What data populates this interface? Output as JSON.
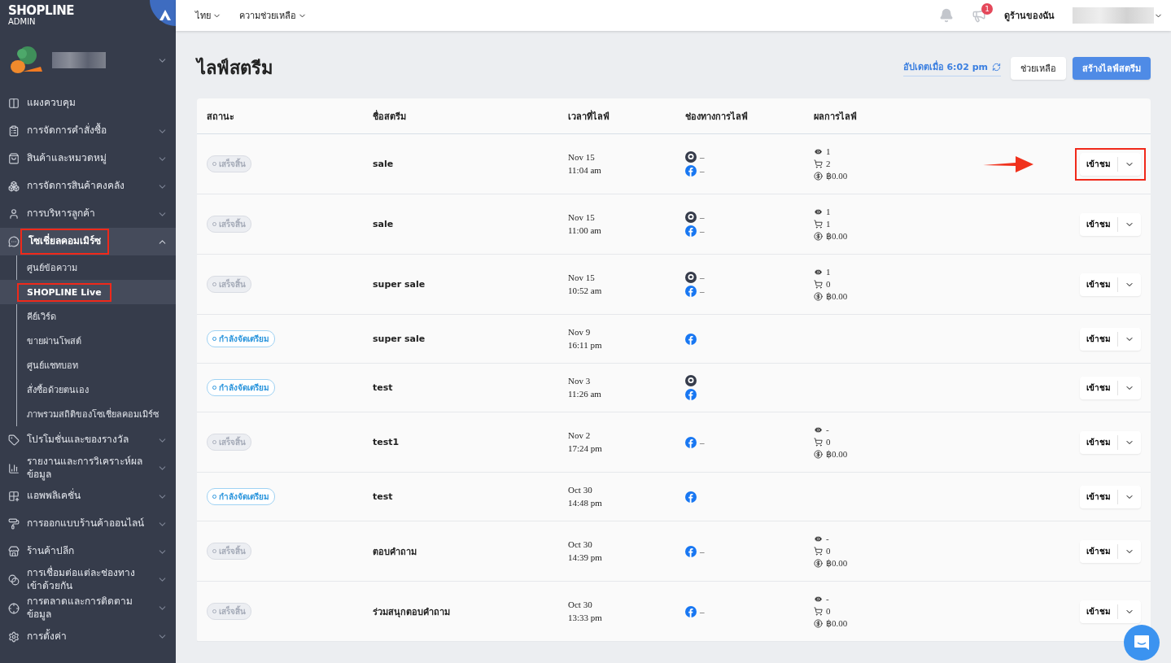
{
  "brand": {
    "name": "SHOPLINE",
    "sub": "ADMIN"
  },
  "sidebar": {
    "items": [
      {
        "label": "แผงควบคุม",
        "selected": false
      },
      {
        "label": "การจัดการคำสั่งซื้อ",
        "expanded": false,
        "selected": false
      },
      {
        "label": "สินค้าและหมวดหมู่",
        "expanded": false,
        "selected": false
      },
      {
        "label": "การจัดการสินค้าคงคลัง",
        "expanded": false,
        "selected": false
      },
      {
        "label": "การบริหารลูกค้า",
        "expanded": false,
        "selected": false
      },
      {
        "label": "โซเชี่ยลคอมเมิร์ซ",
        "expanded": true,
        "selected": true,
        "annotated": true,
        "children": [
          {
            "label": "ศูนย์ข้อความ",
            "selected": false
          },
          {
            "label": "SHOPLINE Live",
            "selected": true,
            "annotated": true
          },
          {
            "label": "คีย์เวิร์ด",
            "selected": false
          },
          {
            "label": "ขายผ่านโพสต์",
            "selected": false
          },
          {
            "label": "ศูนย์แชทบอท",
            "selected": false
          },
          {
            "label": "สั่งซื้อด้วยตนเอง",
            "selected": false
          },
          {
            "label": "ภาพรวมสถิติของโซเชี่ยลคอมเมิร์ซ",
            "selected": false
          }
        ]
      },
      {
        "label": "โปรโมชั่นและของรางวัล",
        "expanded": false,
        "selected": false
      },
      {
        "label": "รายงานและการวิเคราะห์ผลข้อมูล",
        "expanded": false,
        "selected": false
      },
      {
        "label": "แอพพลิเคชั่น",
        "expanded": false,
        "selected": false
      },
      {
        "label": "การออกแบบร้านค้าออนไลน์",
        "expanded": false,
        "selected": false
      },
      {
        "label": "ร้านค้าปลีก",
        "expanded": false,
        "selected": false
      },
      {
        "label": "การเชื่อมต่อแต่ละช่องทางเข้าด้วยกัน",
        "expanded": false,
        "selected": false
      },
      {
        "label": "การตลาดและการติดตามข้อมูล",
        "expanded": false,
        "selected": false
      },
      {
        "label": "การตั้งค่า",
        "expanded": false,
        "selected": false
      }
    ]
  },
  "topbar": {
    "menus": [
      "ไทย",
      "ความช่วยเหลือ"
    ],
    "notification_count": "1",
    "store_link": "ดูร้านของฉัน"
  },
  "page": {
    "title": "ไลฟ์สตรีม",
    "updated": "อัปเดตเมื่อ 6:02 pm",
    "help_button": "ช่วยเหลือ",
    "create_button": "สร้างไลฟ์สตรีม"
  },
  "table": {
    "columns": [
      "สถานะ",
      "ชื่อสตรีม",
      "เวลาที่ไลฟ์",
      "ช่องทางการไลฟ์",
      "ผลการไลฟ์"
    ],
    "rows": [
      {
        "status": {
          "kind": "done",
          "label": "เสร็จสิ้น"
        },
        "name": "sale",
        "date": "Nov 15",
        "time": "11:04 am",
        "channels": [
          {
            "kind": "shopline",
            "value": "–"
          },
          {
            "kind": "facebook",
            "value": "–"
          }
        ],
        "stats": {
          "views": "1",
          "carts": "2",
          "sales": "฿0.00"
        },
        "action": "เข้าชม",
        "annotated": true
      },
      {
        "status": {
          "kind": "done",
          "label": "เสร็จสิ้น"
        },
        "name": "sale",
        "date": "Nov 15",
        "time": "11:00 am",
        "channels": [
          {
            "kind": "shopline",
            "value": "–"
          },
          {
            "kind": "facebook",
            "value": "–"
          }
        ],
        "stats": {
          "views": "1",
          "carts": "1",
          "sales": "฿0.00"
        },
        "action": "เข้าชม"
      },
      {
        "status": {
          "kind": "done",
          "label": "เสร็จสิ้น"
        },
        "name": "super sale",
        "date": "Nov 15",
        "time": "10:52 am",
        "channels": [
          {
            "kind": "shopline",
            "value": "–"
          },
          {
            "kind": "facebook",
            "value": "–"
          }
        ],
        "stats": {
          "views": "1",
          "carts": "0",
          "sales": "฿0.00"
        },
        "action": "เข้าชม"
      },
      {
        "status": {
          "kind": "preparing",
          "label": "กำลังจัดเตรียม"
        },
        "name": "super sale",
        "date": "Nov 9",
        "time": "16:11 pm",
        "channels": [
          {
            "kind": "facebook"
          }
        ],
        "action": "เข้าชม"
      },
      {
        "status": {
          "kind": "preparing",
          "label": "กำลังจัดเตรียม"
        },
        "name": "test",
        "date": "Nov 3",
        "time": "11:26 am",
        "channels": [
          {
            "kind": "shopline"
          },
          {
            "kind": "facebook"
          }
        ],
        "action": "เข้าชม"
      },
      {
        "status": {
          "kind": "done",
          "label": "เสร็จสิ้น"
        },
        "name": "test1",
        "date": "Nov 2",
        "time": "17:24 pm",
        "channels": [
          {
            "kind": "facebook",
            "value": "–"
          }
        ],
        "stats": {
          "views": "-",
          "carts": "0",
          "sales": "฿0.00"
        },
        "action": "เข้าชม"
      },
      {
        "status": {
          "kind": "preparing",
          "label": "กำลังจัดเตรียม"
        },
        "name": "test",
        "date": "Oct 30",
        "time": "14:48 pm",
        "channels": [
          {
            "kind": "facebook"
          }
        ],
        "action": "เข้าชม"
      },
      {
        "status": {
          "kind": "done",
          "label": "เสร็จสิ้น"
        },
        "name": "ตอบคำถาม",
        "date": "Oct 30",
        "time": "14:39 pm",
        "channels": [
          {
            "kind": "facebook",
            "value": "–"
          }
        ],
        "stats": {
          "views": "-",
          "carts": "0",
          "sales": "฿0.00"
        },
        "action": "เข้าชม"
      },
      {
        "status": {
          "kind": "done",
          "label": "เสร็จสิ้น"
        },
        "name": "ร่วมสนุกตอบคำถาม",
        "date": "Oct 30",
        "time": "13:33 pm",
        "channels": [
          {
            "kind": "facebook",
            "value": "–"
          }
        ],
        "stats": {
          "views": "-",
          "carts": "0",
          "sales": "฿0.00"
        },
        "action": "เข้าชม"
      }
    ]
  }
}
